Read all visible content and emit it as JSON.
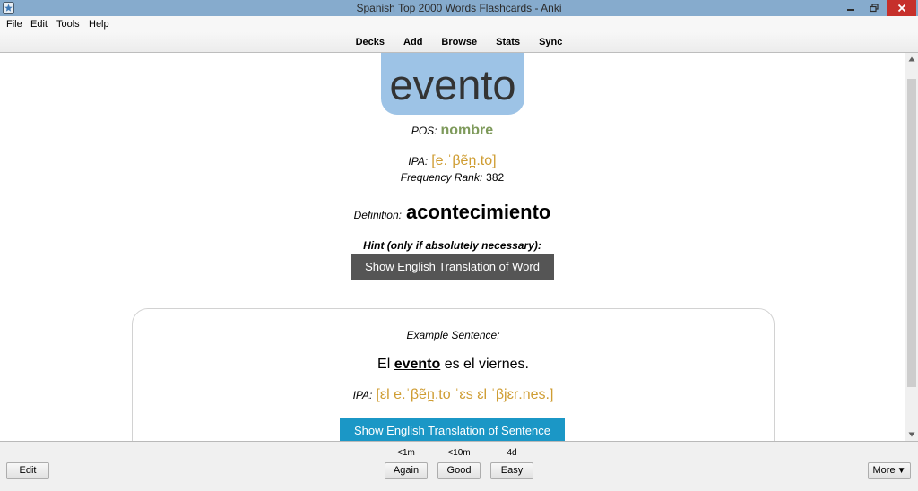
{
  "window": {
    "title": "Spanish Top 2000 Words Flashcards - Anki"
  },
  "menu": {
    "items": [
      "File",
      "Edit",
      "Tools",
      "Help"
    ]
  },
  "toolbar": {
    "items": [
      "Decks",
      "Add",
      "Browse",
      "Stats",
      "Sync"
    ]
  },
  "card": {
    "word": "evento",
    "pos_label": "POS:",
    "pos_value": "nombre",
    "ipa_label": "IPA:",
    "ipa_value": "[e.ˈβẽn̪.to]",
    "rank_label": "Frequency Rank:",
    "rank_value": "382",
    "definition_label": "Definition:",
    "definition_value": "acontecimiento",
    "hint_label": "Hint (only if absolutely necessary):",
    "show_word_translation": "Show English Translation of Word",
    "example": {
      "label": "Example Sentence:",
      "sentence_before": "El ",
      "sentence_word": "evento",
      "sentence_after": " es el viernes.",
      "ipa_label": "IPA:",
      "ipa_value": "[ɛl e.ˈβẽn̪.to ˈɛs ɛl ˈβjɛɾ.nes.]",
      "show_sentence_translation": "Show English Translation of Sentence"
    }
  },
  "answer_bar": {
    "edit": "Edit",
    "buttons": [
      {
        "interval": "<1m",
        "label": "Again"
      },
      {
        "interval": "<10m",
        "label": "Good"
      },
      {
        "interval": "4d",
        "label": "Easy"
      }
    ],
    "more_label": "More",
    "more_caret": "▼"
  },
  "icons": {
    "app": "anki-icon",
    "minimize": "minimize-icon",
    "restore": "restore-icon",
    "close": "close-icon",
    "scroll_up": "scroll-up-arrow-icon",
    "scroll_down": "scroll-down-arrow-icon",
    "more": "caret-down-icon"
  },
  "colors": {
    "titlebar": "#86abcd",
    "close_button": "#c6302b",
    "word_box": "#9dc3e6",
    "word_text": "#333333",
    "pos_value": "#7e9a5b",
    "ipa_value": "#cf9d33",
    "word_button": "#555555",
    "sentence_button": "#1b97c6"
  }
}
